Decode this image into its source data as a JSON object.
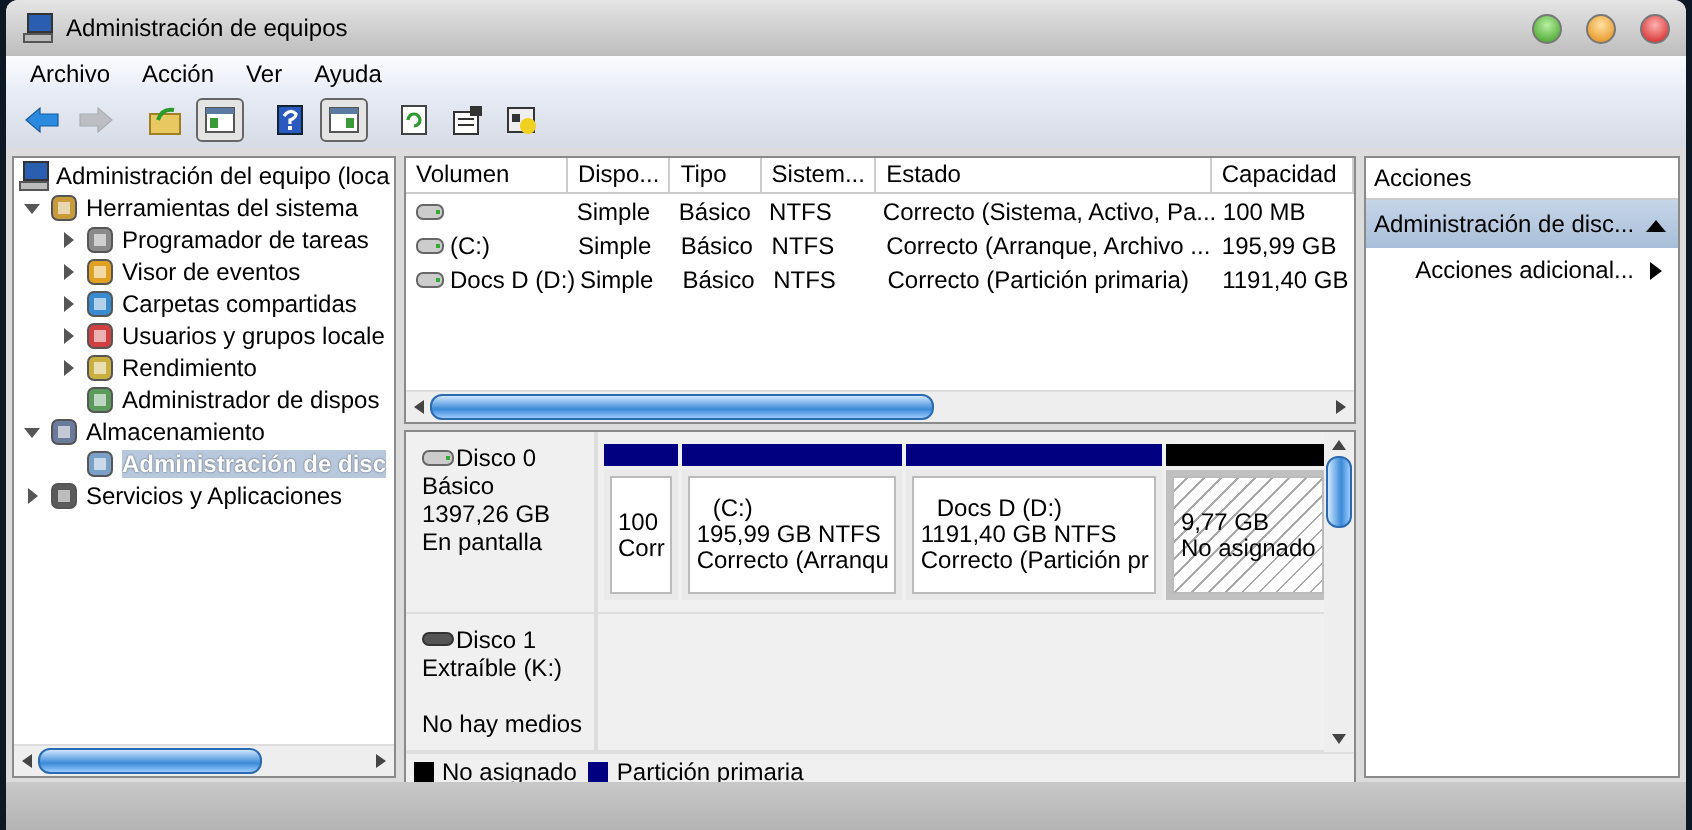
{
  "window": {
    "title": "Administración de equipos"
  },
  "menu": [
    "Archivo",
    "Acción",
    "Ver",
    "Ayuda"
  ],
  "toolbar": [
    {
      "pressed": false,
      "disabled": false
    },
    {
      "pressed": false,
      "disabled": true
    },
    {
      "pressed": false,
      "disabled": false
    },
    {
      "pressed": true,
      "disabled": false
    },
    {
      "pressed": false,
      "disabled": false
    },
    {
      "pressed": true,
      "disabled": false
    },
    {
      "pressed": false,
      "disabled": false
    },
    {
      "pressed": false,
      "disabled": false
    },
    {
      "pressed": false,
      "disabled": false
    }
  ],
  "tree": [
    {
      "label": "Administración del equipo (loca",
      "selected": false,
      "children": [
        {
          "label": "Herramientas del sistema",
          "selected": false,
          "expanded": true,
          "children": [
            {
              "label": "Programador de tareas",
              "selected": false,
              "expanded": false
            },
            {
              "label": "Visor de eventos",
              "selected": false,
              "expanded": false
            },
            {
              "label": "Carpetas compartidas",
              "selected": false,
              "expanded": false
            },
            {
              "label": "Usuarios y grupos locale",
              "selected": false,
              "expanded": false
            },
            {
              "label": "Rendimiento",
              "selected": false,
              "expanded": false
            },
            {
              "label": "Administrador de dispos",
              "selected": false
            }
          ]
        },
        {
          "label": "Almacenamiento",
          "selected": false,
          "expanded": true,
          "children": [
            {
              "label": "Administración de disc",
              "selected": true
            }
          ]
        },
        {
          "label": "Servicios y Aplicaciones",
          "selected": false,
          "expanded": false
        }
      ]
    }
  ],
  "table": {
    "columns": [
      "Volumen",
      "Dispo...",
      "Tipo",
      "Sistem...",
      "Estado",
      "Capacidad"
    ],
    "rows": [
      [
        "",
        "Simple",
        "Básico",
        "NTFS",
        "Correcto (Sistema, Activo, Pa...",
        "100 MB"
      ],
      [
        "(C:)",
        "Simple",
        "Básico",
        "NTFS",
        "Correcto (Arranque, Archivo ...",
        "195,99 GB"
      ],
      [
        "Docs D (D:)",
        "Simple",
        "Básico",
        "NTFS",
        "Correcto (Partición primaria)",
        "1191,40 GB"
      ]
    ]
  },
  "disks": [
    {
      "kind": "basic",
      "name": "Disco 0",
      "info": [
        "Básico",
        "1397,26 GB",
        "En pantalla"
      ],
      "partitions": [
        {
          "kind": "primary",
          "color": "#000080",
          "selected": false,
          "lines": [
            "100",
            "Corr"
          ]
        },
        {
          "kind": "primary",
          "color": "#000080",
          "selected": false,
          "lines": [
            "(C:)",
            "195,99 GB NTFS",
            "Correcto (Arranqu"
          ]
        },
        {
          "kind": "primary",
          "color": "#000080",
          "selected": false,
          "lines": [
            "Docs D  (D:)",
            "1191,40 GB NTFS",
            "Correcto (Partición pr"
          ]
        },
        {
          "kind": "unallocated",
          "color": "#000000",
          "selected": true,
          "lines": [
            "9,77 GB",
            "No asignado"
          ]
        }
      ]
    },
    {
      "kind": "removable",
      "name": "Disco 1",
      "info": [
        "Extraíble (K:)"
      ],
      "footer": "No hay medios"
    }
  ],
  "legend": [
    {
      "label": "No asignado",
      "color": "#000000"
    },
    {
      "label": "Partición primaria",
      "color": "#000080"
    }
  ],
  "actions": {
    "title": "Acciones",
    "section": {
      "label": "Administración de disc...",
      "expanded": true
    },
    "items": [
      "Acciones adicional..."
    ]
  }
}
